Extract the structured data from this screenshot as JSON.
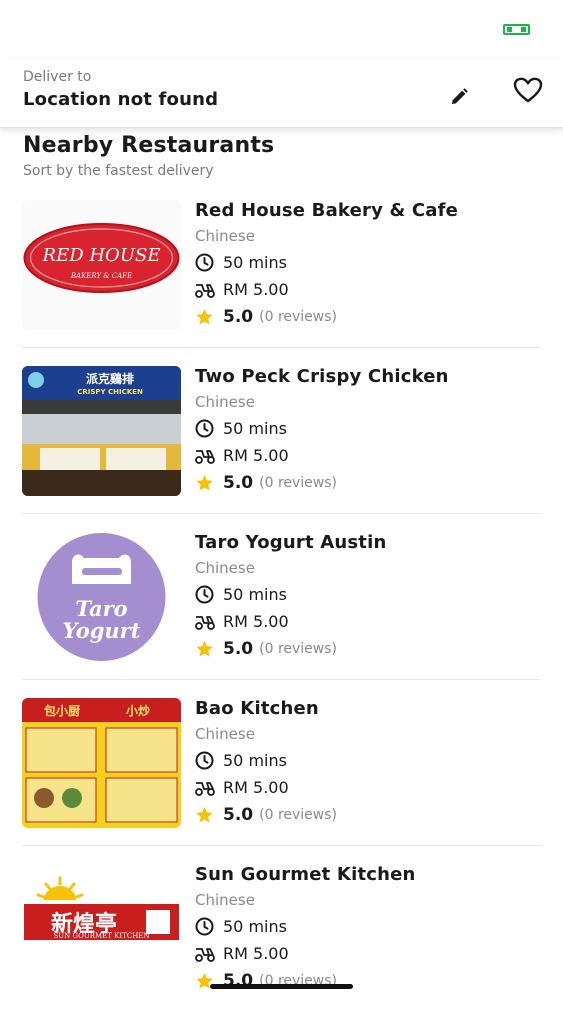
{
  "header": {
    "deliver_label": "Deliver to",
    "location": "Location not found",
    "edit_icon": "pencil-icon",
    "favorite_icon": "heart-icon"
  },
  "section": {
    "title": "Nearby Restaurants",
    "subtitle": "Sort by the fastest delivery"
  },
  "colors": {
    "accent_green": "#22b14c",
    "star": "#f4c20d",
    "text_primary": "#1a1a1a",
    "text_secondary": "#8a8a8a"
  },
  "restaurants": [
    {
      "name": "Red House Bakery & Cafe",
      "cuisine": "Chinese",
      "time": "50 mins",
      "fee": "RM 5.00",
      "rating": "5.0",
      "reviews": "(0 reviews)",
      "logo": {
        "line1": "RED HOUSE",
        "line2": "BAKERY & CAFE"
      }
    },
    {
      "name": "Two Peck Crispy Chicken",
      "cuisine": "Chinese",
      "time": "50 mins",
      "fee": "RM 5.00",
      "rating": "5.0",
      "reviews": "(0 reviews)",
      "logo": {
        "line1": "派克鷄排",
        "line2": "CRISPY CHICKEN"
      }
    },
    {
      "name": "Taro Yogurt Austin",
      "cuisine": "Chinese",
      "time": "50 mins",
      "fee": "RM 5.00",
      "rating": "5.0",
      "reviews": "(0 reviews)",
      "logo": {
        "line1": "Taro",
        "line2": "Yogurt"
      }
    },
    {
      "name": "Bao Kitchen",
      "cuisine": "Chinese",
      "time": "50 mins",
      "fee": "RM 5.00",
      "rating": "5.0",
      "reviews": "(0 reviews)",
      "logo": {
        "line1": "包小厨",
        "line2": "小炒"
      }
    },
    {
      "name": "Sun Gourmet Kitchen",
      "cuisine": "Chinese",
      "time": "50 mins",
      "fee": "RM 5.00",
      "rating": "5.0",
      "reviews": "(0 reviews)",
      "logo": {
        "line1": "新煌亭",
        "line2": "SUN GOURMET KITCHEN"
      }
    }
  ]
}
